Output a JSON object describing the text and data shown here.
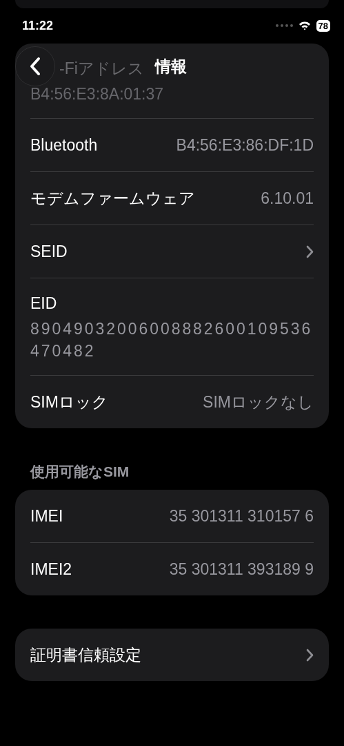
{
  "status_bar": {
    "time": "11:22",
    "battery": "78"
  },
  "nav": {
    "title": "情報"
  },
  "info_rows": [
    {
      "kind": "stacked",
      "label": "-Fiアドレス",
      "value": "B4:56:E3:8A:01:37",
      "obscured": true
    },
    {
      "kind": "inline",
      "label": "Bluetooth",
      "value": "B4:56:E3:86:DF:1D",
      "obscured": false
    },
    {
      "kind": "inline",
      "label": "モデムファームウェア",
      "value": "6.10.01",
      "obscured": false
    },
    {
      "kind": "chevron",
      "label": "SEID",
      "obscured": false
    },
    {
      "kind": "stacked",
      "label": "EID",
      "value": "89049032006008882600109536470482",
      "obscured": false
    },
    {
      "kind": "inline",
      "label": "SIMロック",
      "value": "SIMロックなし",
      "obscured": false
    }
  ],
  "sim_section": {
    "header": "使用可能なSIM",
    "rows": [
      {
        "kind": "inline",
        "label": "IMEI",
        "value": "35 301311 310157 6"
      },
      {
        "kind": "inline",
        "label": "IMEI2",
        "value": "35 301311 393189 9"
      }
    ]
  },
  "trust_rows": [
    {
      "kind": "chevron",
      "label": "証明書信頼設定"
    }
  ]
}
